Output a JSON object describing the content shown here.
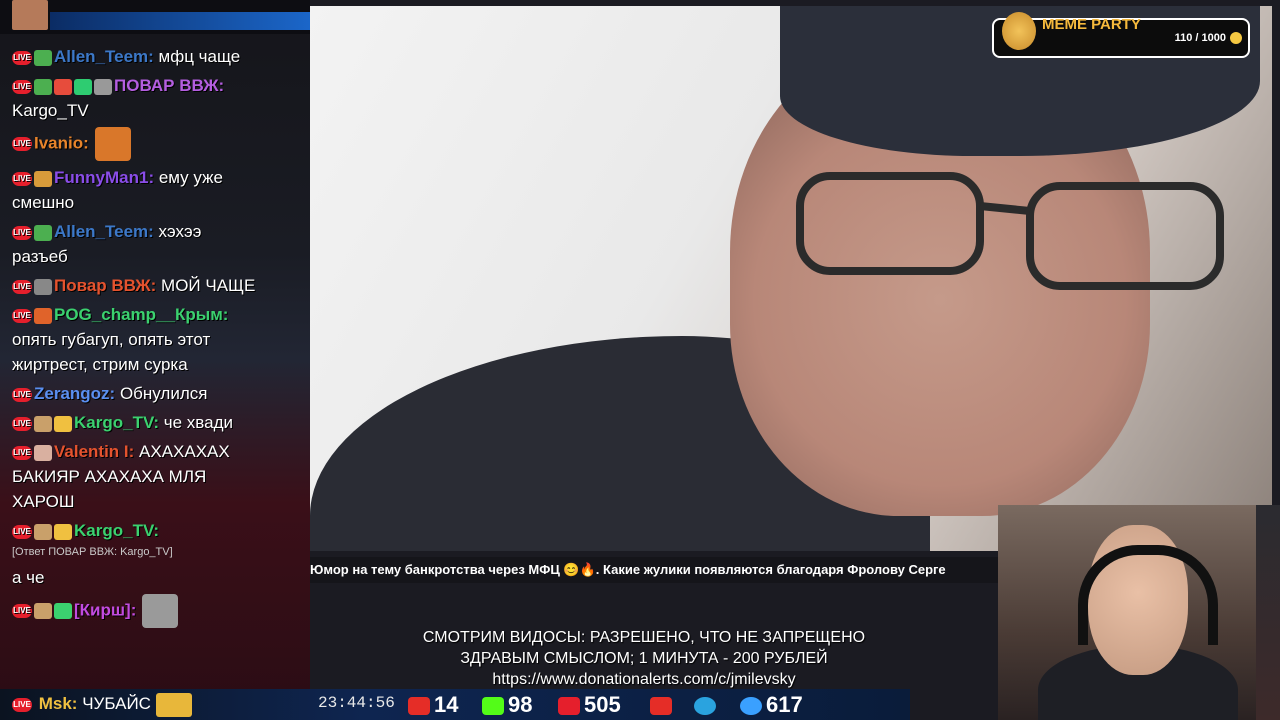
{
  "chat": {
    "messages": [
      {
        "user": "Allen_Teem:",
        "user_color": "#3c78c8",
        "text": "мфц чаще",
        "emotes": [
          "#4caf50"
        ]
      },
      {
        "user": "ПОВАР ВВЖ:",
        "user_color": "#b45ee0",
        "text": "",
        "second_line": "Kargo_TV",
        "emotes": [
          "#4caf50",
          "#e74c3c",
          "#2ecc71",
          "#999999"
        ]
      },
      {
        "user": "Ivanio:",
        "user_color": "#e8842a",
        "text": "",
        "emotes": []
      },
      {
        "user": "FunnyMan1:",
        "user_color": "#8a4de8",
        "text": "ему уже",
        "second_line": "смешно",
        "emotes": [
          "#d89b3a"
        ]
      },
      {
        "user": "Allen_Teem:",
        "user_color": "#3c78c8",
        "text": "хэхээ",
        "second_line": "разъеб",
        "emotes": [
          "#4caf50"
        ]
      },
      {
        "user": "Повар ВВЖ:",
        "user_color": "#e5532e",
        "text": "МОЙ ЧАЩЕ",
        "emotes": [
          "#888888"
        ]
      },
      {
        "user": "POG_champ__Крым:",
        "user_color": "#3bd16f",
        "text": "",
        "second_line": "опять губагуп, опять этот",
        "third_line": "жиртрест, стрим сурка",
        "emotes": [
          "#e0632a"
        ]
      },
      {
        "user": "Zerangoz:",
        "user_color": "#5a8ff0",
        "text": "Обнулился",
        "emotes": []
      },
      {
        "user": "Kargo_TV:",
        "user_color": "#3bd16f",
        "text": "че хвади",
        "emotes": [
          "#c9a06a",
          "#f0c040"
        ]
      },
      {
        "user": "Valentin I:",
        "user_color": "#e5532e",
        "text": "АХАХАХАХ",
        "second_line": "БАКИЯР АХАХАХА МЛЯ",
        "third_line": "ХАРОШ",
        "emotes": [
          "#d9b0a0"
        ]
      },
      {
        "user": "Kargo_TV:",
        "user_color": "#3bd16f",
        "text": "",
        "emotes": [
          "#c9a06a",
          "#f0c040"
        ]
      },
      {
        "reply": "[Ответ ПОВАР ВВЖ: Kargo_TV]",
        "text_only": "а че"
      },
      {
        "user": "[Кирш]:",
        "user_color": "#c24be0",
        "text": "",
        "emotes": [
          "#c9a06a",
          "#3bd16f"
        ]
      }
    ],
    "last": {
      "user": "Msk:",
      "user_color": "#f0c040",
      "text": "ЧУБАЙС"
    }
  },
  "ticker": {
    "text": "Юмор на тему банкротства через МФЦ 😊🔥. Какие жулики появляются благодаря Фролову Серге"
  },
  "overlay": {
    "line1": "СМОТРИМ ВИДОСЫ: РАЗРЕШЕНО, ЧТО НЕ ЗАПРЕЩЕНО",
    "line2": "ЗДРАВЫМ СМЫСЛОМ; 1 МИНУТА - 200 РУБЛЕЙ",
    "line3": "https://www.donationalerts.com/c/jmilevsky"
  },
  "meme_party": {
    "title": "MEME PARTY",
    "count": "110 / 1000"
  },
  "stats": {
    "time": "23:44:56",
    "youtube": "14",
    "kick": "98",
    "live": "505",
    "viewers": "617"
  },
  "colors": {
    "youtube": "#e52d27",
    "kick": "#53fc18",
    "live": "#e51f2c",
    "telegram": "#2aa3df",
    "viewers": "#3aa0ff"
  }
}
